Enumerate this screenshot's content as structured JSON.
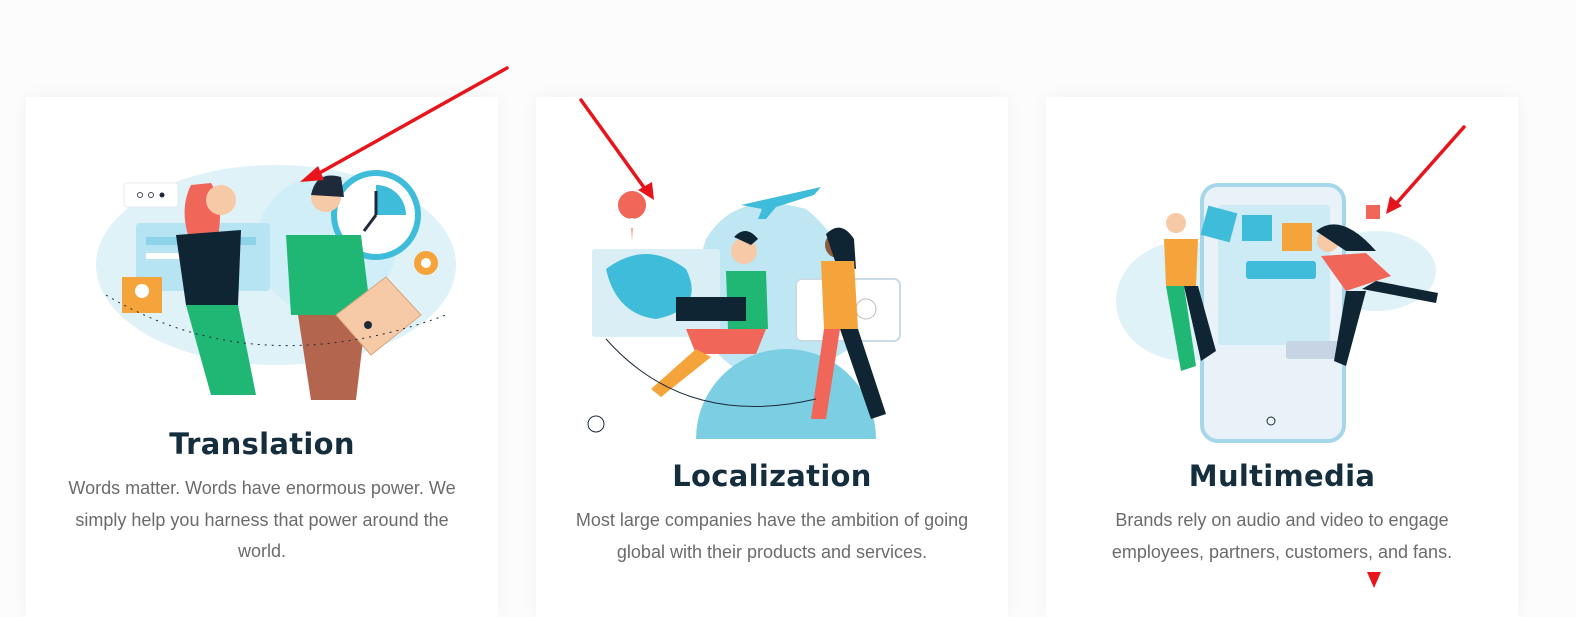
{
  "cards": [
    {
      "title": "Translation",
      "text": "Words matter. Words have enormous power. We simply help you harness that power around the world.",
      "illustration": "translation-illustration"
    },
    {
      "title": "Localization",
      "text": "Most large companies have the ambition of going global with their products and services.",
      "illustration": "localization-illustration"
    },
    {
      "title": "Multimedia",
      "text": "Brands rely on audio and video to engage employees, partners, customers, and fans.",
      "illustration": "multimedia-illustration"
    }
  ],
  "colors": {
    "heading": "#142e3e",
    "body_text": "#6b6b6b",
    "annotation_arrow": "#e8141b",
    "illustration_teal": "#3fbcd9",
    "illustration_green": "#20b673",
    "illustration_coral": "#f0675a",
    "illustration_orange": "#f5a33b"
  }
}
